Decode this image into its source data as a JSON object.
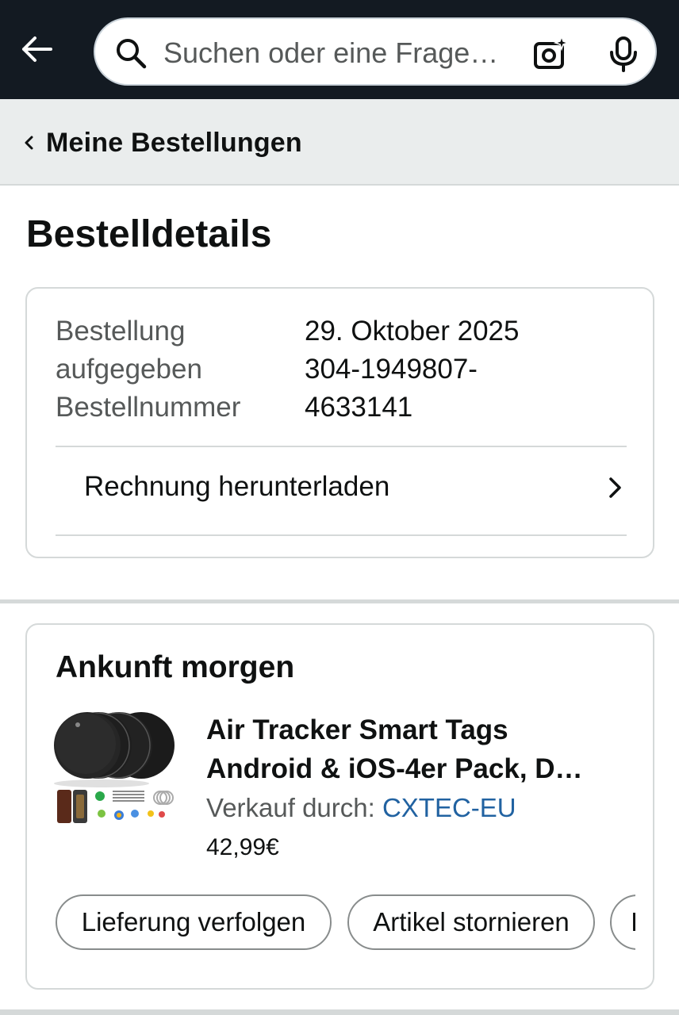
{
  "search": {
    "placeholder": "Suchen oder eine Frage…"
  },
  "breadcrumb": {
    "label": "Meine Bestellungen"
  },
  "page": {
    "title": "Bestelldetails"
  },
  "order_info": {
    "label_placed_1": "Bestellung",
    "label_placed_2": "aufgegeben",
    "label_number": "Bestellnummer",
    "placed_date": "29. Oktober 2025",
    "order_number_1": "304-1949807-",
    "order_number_2": "4633141",
    "invoice_label": "Rechnung herunterladen"
  },
  "delivery": {
    "status": "Ankunft morgen",
    "product": {
      "title_line1": "Air Tracker Smart Tags",
      "title_line2": "Android & iOS-4er Pack, D…",
      "seller_prefix": "Verkauf durch: ",
      "seller_name": "CXTEC-EU",
      "price": "42,99€"
    },
    "actions": {
      "track": "Lieferung verfolgen",
      "cancel": "Artikel stornieren",
      "more": "I"
    }
  },
  "colors": {
    "header_bg": "#131a22",
    "breadcrumb_bg": "#eaeded",
    "link": "#2162a1",
    "secondary_text": "#565959",
    "border": "#d5d9d9"
  },
  "icons": [
    "back-arrow-icon",
    "search-icon",
    "camera-icon",
    "mic-icon",
    "chevron-left-icon",
    "chevron-right-icon"
  ]
}
